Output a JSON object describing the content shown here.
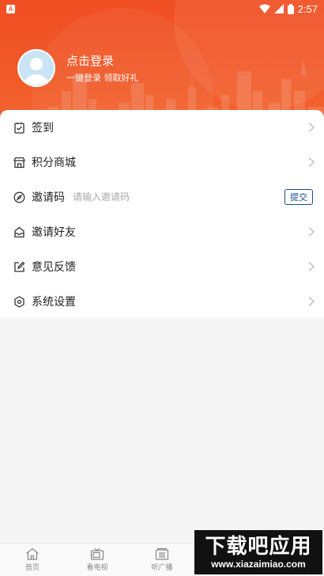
{
  "status_bar": {
    "time": "2:57",
    "battery": "8",
    "app_icon_letter": "A"
  },
  "header": {
    "login_title": "点击登录",
    "login_subtitle": "一键登录  领取好礼",
    "background_color": "#f04e23"
  },
  "menu": {
    "items": [
      {
        "icon": "sign-in-icon",
        "label": "签到"
      },
      {
        "icon": "store-icon",
        "label": "积分商城"
      },
      {
        "icon": "compass-icon",
        "label": "邀请码"
      },
      {
        "icon": "inbox-icon",
        "label": "邀请好友"
      },
      {
        "icon": "edit-icon",
        "label": "意见反馈"
      },
      {
        "icon": "settings-icon",
        "label": "系统设置"
      }
    ],
    "invite_placeholder": "请输入邀请码",
    "submit_label": "提交",
    "submit_color": "#1a4a8a"
  },
  "tabbar": {
    "tabs": [
      {
        "icon": "home-icon",
        "label": "首页"
      },
      {
        "icon": "tv-icon",
        "label": "看电视"
      },
      {
        "icon": "radio-icon",
        "label": "听广播"
      }
    ]
  },
  "watermark": {
    "title": "下载吧应用",
    "url": "www.xiazaimiao.com"
  }
}
